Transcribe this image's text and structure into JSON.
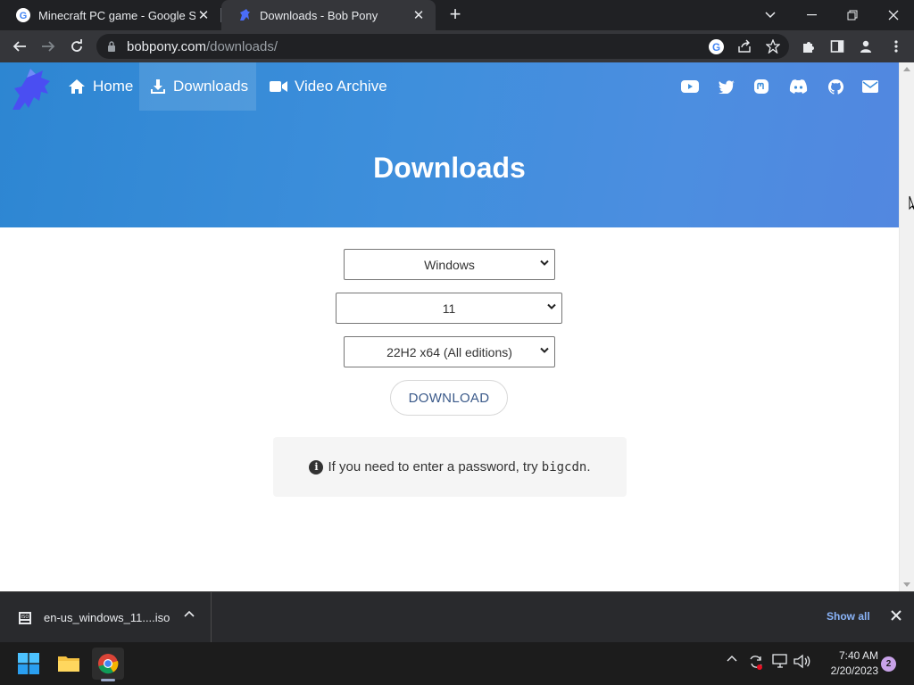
{
  "browser": {
    "tabs": [
      {
        "title": "Minecraft PC game - Google Sea",
        "favicon": "google-icon",
        "active": false
      },
      {
        "title": "Downloads - Bob Pony",
        "favicon": "bobpony-icon",
        "active": true
      }
    ],
    "url_host": "bobpony.com",
    "url_path": "/downloads/"
  },
  "site": {
    "nav": [
      {
        "label": "Home",
        "icon": "home-icon"
      },
      {
        "label": "Downloads",
        "icon": "download-icon"
      },
      {
        "label": "Video Archive",
        "icon": "video-camera-icon"
      }
    ],
    "social": [
      "youtube-icon",
      "twitter-icon",
      "mastodon-icon",
      "discord-icon",
      "github-icon",
      "mail-icon"
    ],
    "page_title": "Downloads",
    "os_select": "Windows",
    "version_select": "11",
    "build_select": "22H2 x64 (All editions)",
    "download_label": "DOWNLOAD",
    "notice_text": "If you need to enter a password, try ",
    "notice_code": "bigcdn",
    "notice_end": ".",
    "brand_color": "#3e8fdc"
  },
  "download_shelf": {
    "filename": "en-us_windows_11....iso",
    "show_all": "Show all"
  },
  "taskbar": {
    "time": "7:40 AM",
    "date": "2/20/2023",
    "notification_count": "2"
  }
}
